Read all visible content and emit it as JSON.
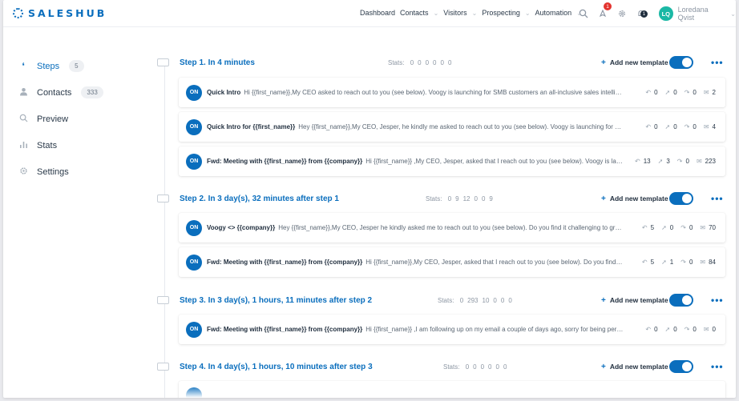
{
  "app": {
    "brand": "SALESHUB"
  },
  "nav": {
    "items": [
      {
        "label": "Dashboard",
        "has_menu": false
      },
      {
        "label": "Contacts",
        "has_menu": true
      },
      {
        "label": "Visitors",
        "has_menu": true
      },
      {
        "label": "Prospecting",
        "has_menu": true
      },
      {
        "label": "Automation",
        "has_menu": true
      }
    ],
    "notifications_badge": "1",
    "alerts_badge": "1"
  },
  "user": {
    "initials": "LQ",
    "name": "Loredana Qvist"
  },
  "sidebar": {
    "items": [
      {
        "label": "Steps",
        "count": "5",
        "icon": "footsteps-icon",
        "active": true
      },
      {
        "label": "Contacts",
        "count": "333",
        "icon": "person-icon",
        "active": false
      },
      {
        "label": "Preview",
        "count": "",
        "icon": "search-icon",
        "active": false
      },
      {
        "label": "Stats",
        "count": "",
        "icon": "bar-chart-icon",
        "active": false
      },
      {
        "label": "Settings",
        "count": "",
        "icon": "gear-icon",
        "active": false
      }
    ]
  },
  "steps": [
    {
      "title": "Step 1. In 4 minutes",
      "stats_label": "Stats:",
      "stats": [
        "0",
        "0",
        "0",
        "0",
        "0",
        "0"
      ],
      "add_label": "Add new template",
      "templates": [
        {
          "status": "ON",
          "subject": "Quick Intro",
          "preview": "Hi {{first_name}},My CEO asked to reach out to you (see below). Voogy is launching for SMB customers an all-inclusive sales intelligence platform...",
          "metrics": [
            "0",
            "0",
            "0",
            "2"
          ]
        },
        {
          "status": "ON",
          "subject": "Quick Intro for {{first_name}}",
          "preview": "Hey {{first_name}},My CEO, Jesper, he kindly me asked to reach out to you (see below). Voogy is launching for SMB customers...",
          "metrics": [
            "0",
            "0",
            "0",
            "4"
          ]
        },
        {
          "status": "ON",
          "subject": "Fwd: Meeting with {{first_name}} from {{company}}",
          "preview": "Hi {{first_name}} ,My CEO, Jesper, asked that I reach out to you (see below). Voogy is launching...",
          "metrics": [
            "13",
            "3",
            "0",
            "223"
          ]
        }
      ]
    },
    {
      "title": "Step 2. In 3 day(s), 32 minutes after step 1",
      "stats_label": "Stats:",
      "stats": [
        "0",
        "9",
        "12",
        "0",
        "0",
        "9"
      ],
      "add_label": "Add new template",
      "templates": [
        {
          "status": "ON",
          "subject": "Voogy <> {{company}}",
          "preview": "Hey {{first_name}},My CEO, Jesper he kindly asked me to reach out to you (see below). Do you find it challenging to grow your pipeline...",
          "metrics": [
            "5",
            "0",
            "0",
            "70"
          ]
        },
        {
          "status": "ON",
          "subject": "Fwd: Meeting with {{first_name}} from {{company}}",
          "preview": "Hi {{first_name}},My CEO, Jesper, asked that I reach out to you (see below). Do you find it challenging...",
          "metrics": [
            "5",
            "1",
            "0",
            "84"
          ]
        }
      ]
    },
    {
      "title": "Step 3. In 3 day(s), 1 hours, 11 minutes after step 2",
      "stats_label": "Stats:",
      "stats": [
        "0",
        "293",
        "10",
        "0",
        "0",
        "0"
      ],
      "add_label": "Add new template",
      "templates": [
        {
          "status": "ON",
          "subject": "Fwd: Meeting with {{first_name}} from {{company}}",
          "preview": "Hi {{first_name}} ,I am following up on my email a couple of days ago, sorry for being persistent...",
          "metrics": [
            "0",
            "0",
            "0",
            "0"
          ]
        }
      ]
    },
    {
      "title": "Step 4. In 4 day(s), 1 hours, 10 minutes after step 3",
      "stats_label": "Stats:",
      "stats": [
        "0",
        "0",
        "0",
        "0",
        "0",
        "0"
      ],
      "add_label": "Add new template",
      "templates": []
    }
  ]
}
